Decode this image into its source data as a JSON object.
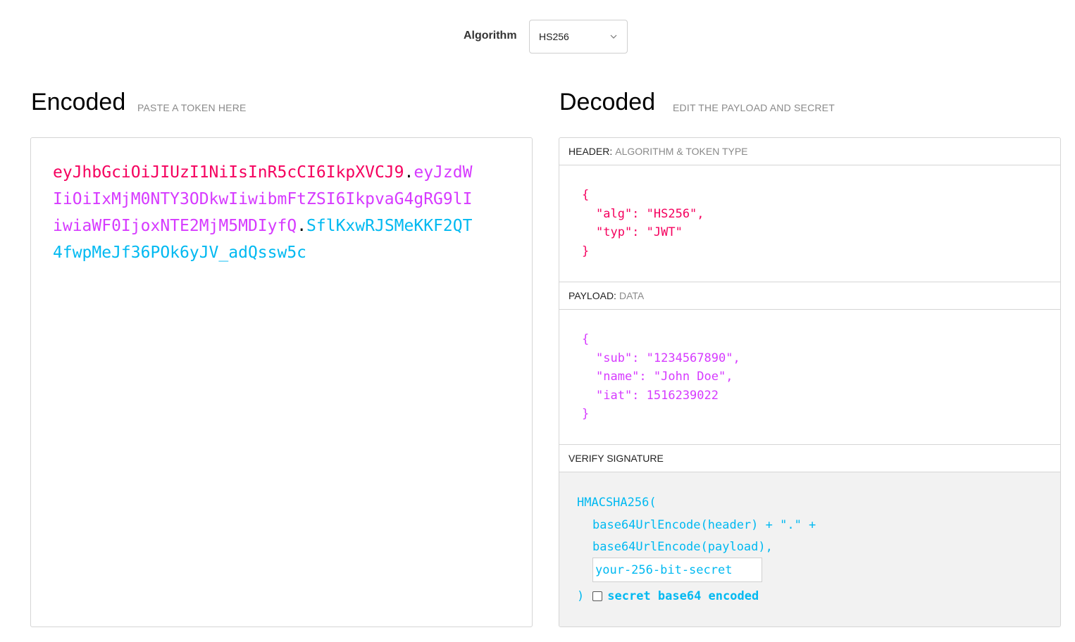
{
  "algorithm": {
    "label": "Algorithm",
    "selected": "HS256",
    "icon": "chevron-down-icon"
  },
  "encoded": {
    "title": "Encoded",
    "subtitle": "PASTE A TOKEN HERE",
    "token": {
      "header": "eyJhbGciOiJIUzI1NiIsInR5cCI6IkpXVCJ9",
      "payload": "eyJzdWIiOiIxMjM0NTY3ODkwIiwibmFtZSI6IkpvaG4gRG9lIiwiaWF0IjoxNTE2MjM5MDIyfQ",
      "signature": "SflKxwRJSMeKKF2QT4fwpMeJf36POk6yJV_adQssw5c",
      "separator": "."
    }
  },
  "decoded": {
    "title": "Decoded",
    "subtitle": "EDIT THE PAYLOAD AND SECRET",
    "header_section": {
      "label": "HEADER:",
      "sublabel": "ALGORITHM & TOKEN TYPE",
      "lines": [
        "{",
        "\"alg\": \"HS256\",",
        "\"typ\": \"JWT\"",
        "}"
      ]
    },
    "payload_section": {
      "label": "PAYLOAD:",
      "sublabel": "DATA",
      "lines": [
        "{",
        "\"sub\": \"1234567890\",",
        "\"name\": \"John Doe\",",
        "\"iat\": 1516239022",
        "}"
      ]
    },
    "signature_section": {
      "label": "VERIFY SIGNATURE",
      "func_open": "HMACSHA256(",
      "line1": "base64UrlEncode(header) + \".\" +",
      "line2": "base64UrlEncode(payload),",
      "secret_placeholder": "your-256-bit-secret",
      "func_close": ")",
      "checkbox_label": "secret base64 encoded",
      "checkbox_checked": false
    }
  },
  "colors": {
    "header": "#f5005e",
    "payload": "#d63aff",
    "signature": "#00b9f1"
  }
}
